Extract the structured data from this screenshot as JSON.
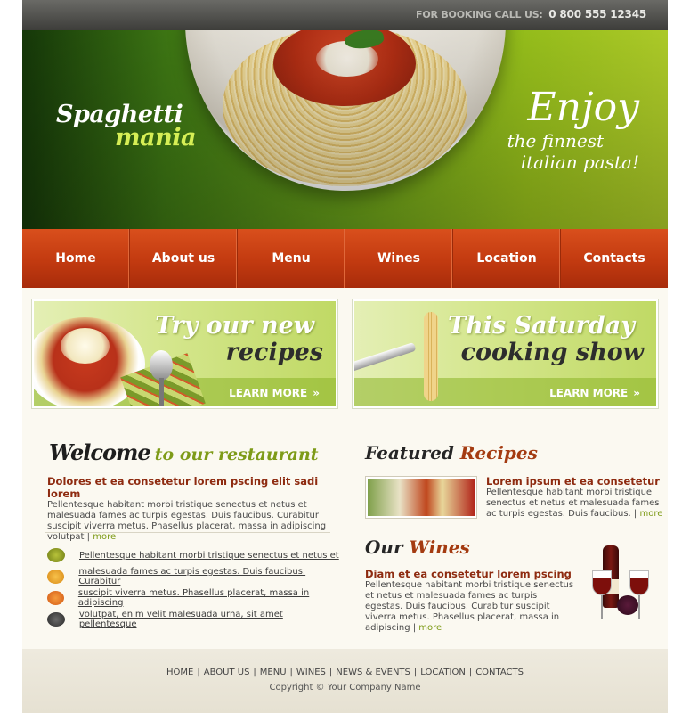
{
  "topbar": {
    "booking_label": "FOR BOOKING CALL US:",
    "phone": "0 800 555 12345"
  },
  "logo": {
    "line1": "Spaghetti",
    "line2": "mania"
  },
  "hero": {
    "slogan1": "Enjoy",
    "slogan2": "the finnest",
    "slogan3": "italian pasta!"
  },
  "nav": [
    "Home",
    "About us",
    "Menu",
    "Wines",
    "Location",
    "Contacts"
  ],
  "banners": [
    {
      "title1": "Try our new",
      "title2": "recipes",
      "cta": "LEARN MORE",
      "cta_icon": "»"
    },
    {
      "title1": "This Saturday",
      "title2": "cooking show",
      "cta": "LEARN MORE",
      "cta_icon": "»"
    }
  ],
  "welcome": {
    "title_a": "Welcome",
    "title_b": "to our restaurant",
    "subtitle": "Dolores et ea consetetur lorem pscing elit sadi lorem",
    "text": "Pellentesque habitant morbi tristique senectus et netus et malesuada fames ac turpis egestas. Duis faucibus. Curabitur suscipit viverra metus. Phasellus placerat, massa in adipiscing volutpat",
    "more": "more"
  },
  "list": [
    "Pellentesque habitant morbi tristique senectus et netus et",
    "malesuada fames ac turpis egestas. Duis faucibus. Curabitur",
    "suscipit viverra metus. Phasellus placerat, massa in adipiscing",
    "volutpat, enim velit malesuada urna, sit amet pellentesque"
  ],
  "featured": {
    "title_a": "Featured",
    "title_b": "Recipes",
    "subtitle": "Lorem ipsum et ea consetetur",
    "text": "Pellentesque habitant morbi tristique senectus et netus et malesuada fames ac turpis egestas. Duis faucibus.",
    "more": "more"
  },
  "wines": {
    "title_a": "Our",
    "title_b": "Wines",
    "subtitle": "Diam et ea consetetur lorem pscing",
    "text": "Pellentesque habitant morbi tristique senectus et netus et malesuada fames ac turpis egestas. Duis faucibus. Curabitur suscipit viverra metus. Phasellus placerat, massa in adipiscing",
    "more": "more"
  },
  "footer": {
    "links": [
      "HOME",
      "ABOUT US",
      "MENU",
      "WINES",
      "NEWS & EVENTS",
      "LOCATION",
      "CONTACTS"
    ],
    "copyright": "Copyright © Your Company Name"
  },
  "colors": {
    "accent_green": "#7e9b18",
    "nav_red": "#c23a10",
    "title_red": "#8e2b10"
  }
}
